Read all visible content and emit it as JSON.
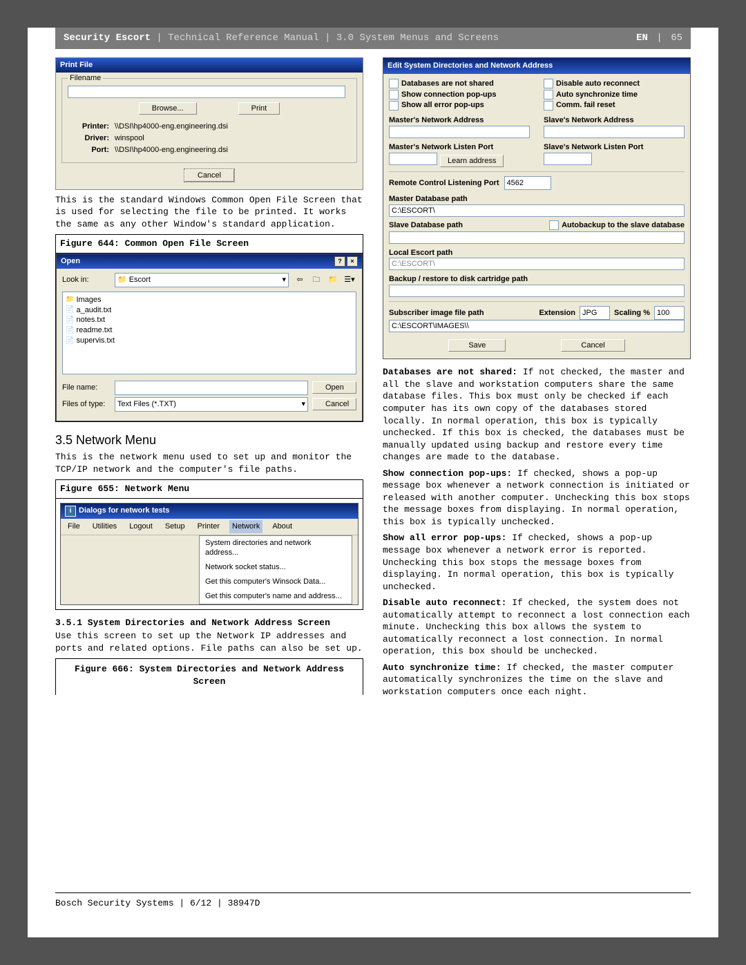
{
  "header": {
    "prod": "Security Escort",
    "doc": " | Technical Reference Manual | 3.0  System Menus and Screens",
    "lang": "EN",
    "page": "65"
  },
  "left": {
    "printDlg": {
      "title": "Print File",
      "group": "Filename",
      "browse": "Browse...",
      "print": "Print",
      "printerLab": "Printer:",
      "printerVal": "\\\\DSI\\hp4000-eng.engineering.dsi",
      "driverLab": "Driver:",
      "driverVal": "winspool",
      "portLab": "Port:",
      "portVal": "\\\\DSI\\hp4000-eng.engineering.dsi",
      "cancel": "Cancel"
    },
    "printText": "This is the standard Windows Common Open File Screen that is used for selecting the file to be printed. It works the same as any other Window's standard application.",
    "fig644": "Figure 644: Common Open File Screen",
    "openDlg": {
      "title": "Open",
      "lookIn": "Look in:",
      "folder": "Escort",
      "files": [
        "Images",
        "a_audit.txt",
        "notes.txt",
        "readme.txt",
        "supervis.txt"
      ],
      "fileNameLab": "File name:",
      "fileTypeLab": "Files of type:",
      "fileTypeVal": "Text Files (*.TXT)",
      "open": "Open",
      "cancel": "Cancel"
    },
    "h35": "3.5   Network Menu",
    "h35text": "This is the network menu used to set up and monitor the TCP/IP network and the computer's file paths.",
    "fig655": "Figure 655: Network Menu",
    "netDlg": {
      "title": "Dialogs for network tests",
      "menu": [
        "File",
        "Utilities",
        "Logout",
        "Setup",
        "Printer",
        "Network",
        "About"
      ],
      "sub": [
        "System directories and network address...",
        "Network socket status...",
        "Get this computer's Winsock Data...",
        "Get this computer's name and address..."
      ]
    },
    "h351": "3.5.1 System Directories and Network Address Screen",
    "h351text": "Use this screen to set up the Network IP addresses and ports and related options. File paths can also be set up.",
    "fig666": "Figure 666: System Directories and Network Address Screen"
  },
  "right": {
    "sysDlg": {
      "title": "Edit System Directories and Network Address",
      "chk": {
        "dbNotShared": "Databases are not shared",
        "disableAuto": "Disable auto reconnect",
        "showConn": "Show connection pop-ups",
        "autoSync": "Auto synchronize time",
        "showErr": "Show all error pop-ups",
        "commFail": "Comm. fail reset"
      },
      "mAddr": "Master's Network Address",
      "sAddr": "Slave's Network Address",
      "mPort": "Master's Network Listen Port",
      "sPort": "Slave's Network Listen Port",
      "learn": "Learn address",
      "rcPort": "Remote Control Listening Port",
      "rcPortVal": "4562",
      "mdbPath": "Master Database path",
      "mdbVal": "C:\\ESCORT\\",
      "sdbPath": "Slave Database path",
      "autobackup": "Autobackup to the slave database",
      "lEscort": "Local Escort path",
      "lEscortVal": "C:\\ESCORT\\",
      "backup": "Backup / restore to disk cartridge path",
      "subImg": "Subscriber image file path",
      "extLab": "Extension",
      "extVal": "JPG",
      "scaleLab": "Scaling %",
      "scaleVal": "100",
      "subImgVal": "C:\\ESCORT\\IMAGES\\\\",
      "save": "Save",
      "cancel": "Cancel"
    },
    "terms": {
      "t1lab": "Databases are not shared:",
      "t1txt": "  If not checked, the master and all the slave and workstation computers share the same database files. This box must only be checked if each computer has its own copy of the databases stored locally. In normal operation, this box is typically unchecked. If this box is checked, the databases must be manually updated using backup and restore every time changes are made to the database.",
      "t2lab": "Show connection pop-ups:",
      "t2txt": "  If checked, shows a pop-up message box whenever a network connection is initiated or released with another computer. Unchecking this box stops the message boxes from displaying. In normal operation, this box is typically unchecked.",
      "t3lab": "Show all error pop-ups:",
      "t3txt": "  If checked, shows a pop-up message box whenever a network error is reported. Unchecking this box stops the message boxes from displaying. In normal operation, this box is typically unchecked.",
      "t4lab": "Disable auto reconnect:",
      "t4txt": "  If checked, the system does not automatically attempt to reconnect a lost connection each minute. Unchecking this box allows the system to automatically reconnect a lost connection. In normal operation, this box should be unchecked.",
      "t5lab": "Auto synchronize time:",
      "t5txt": "  If checked, the master computer automatically synchronizes the time on the slave and workstation computers once each night."
    }
  },
  "footer": "Bosch Security Systems | 6/12 | 38947D"
}
